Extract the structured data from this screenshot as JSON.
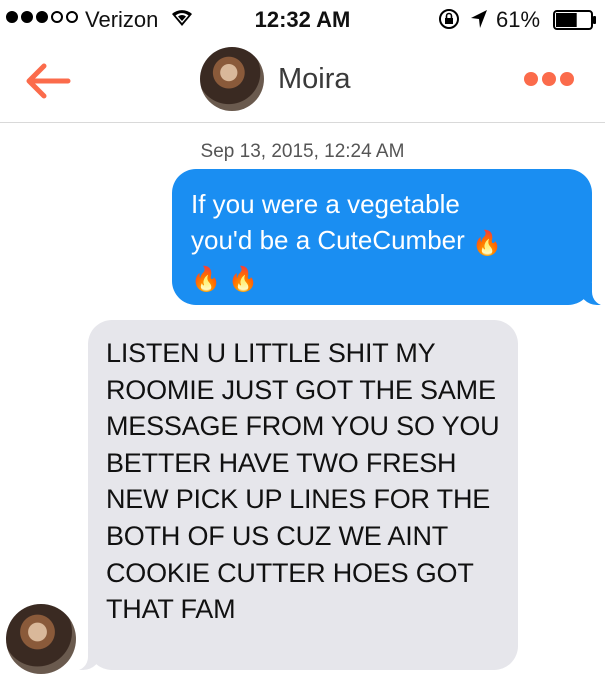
{
  "status_bar": {
    "carrier": "Verizon",
    "signal_bars_filled": 3,
    "signal_bars_total": 5,
    "time": "12:32 AM",
    "battery_percent": "61%",
    "battery_level": 0.61
  },
  "header": {
    "contact_name": "Moira",
    "accent_color": "#fb6b4b"
  },
  "conversation": {
    "timestamp": "Sep 13, 2015, 12:24 AM",
    "messages": [
      {
        "direction": "outgoing",
        "text_line1": "If you were a vegetable",
        "text_line2": "you'd be a CuteCumber",
        "emoji": "🔥",
        "bubble_color": "#1a8ef2"
      },
      {
        "direction": "incoming",
        "text": "LISTEN U LITTLE SHIT MY ROOMIE JUST GOT THE SAME MESSAGE FROM YOU SO YOU BETTER HAVE TWO FRESH NEW PICK UP LINES FOR THE BOTH OF US CUZ WE AINT COOKIE CUTTER HOES GOT THAT FAM",
        "bubble_color": "#e6e6eb"
      }
    ]
  }
}
